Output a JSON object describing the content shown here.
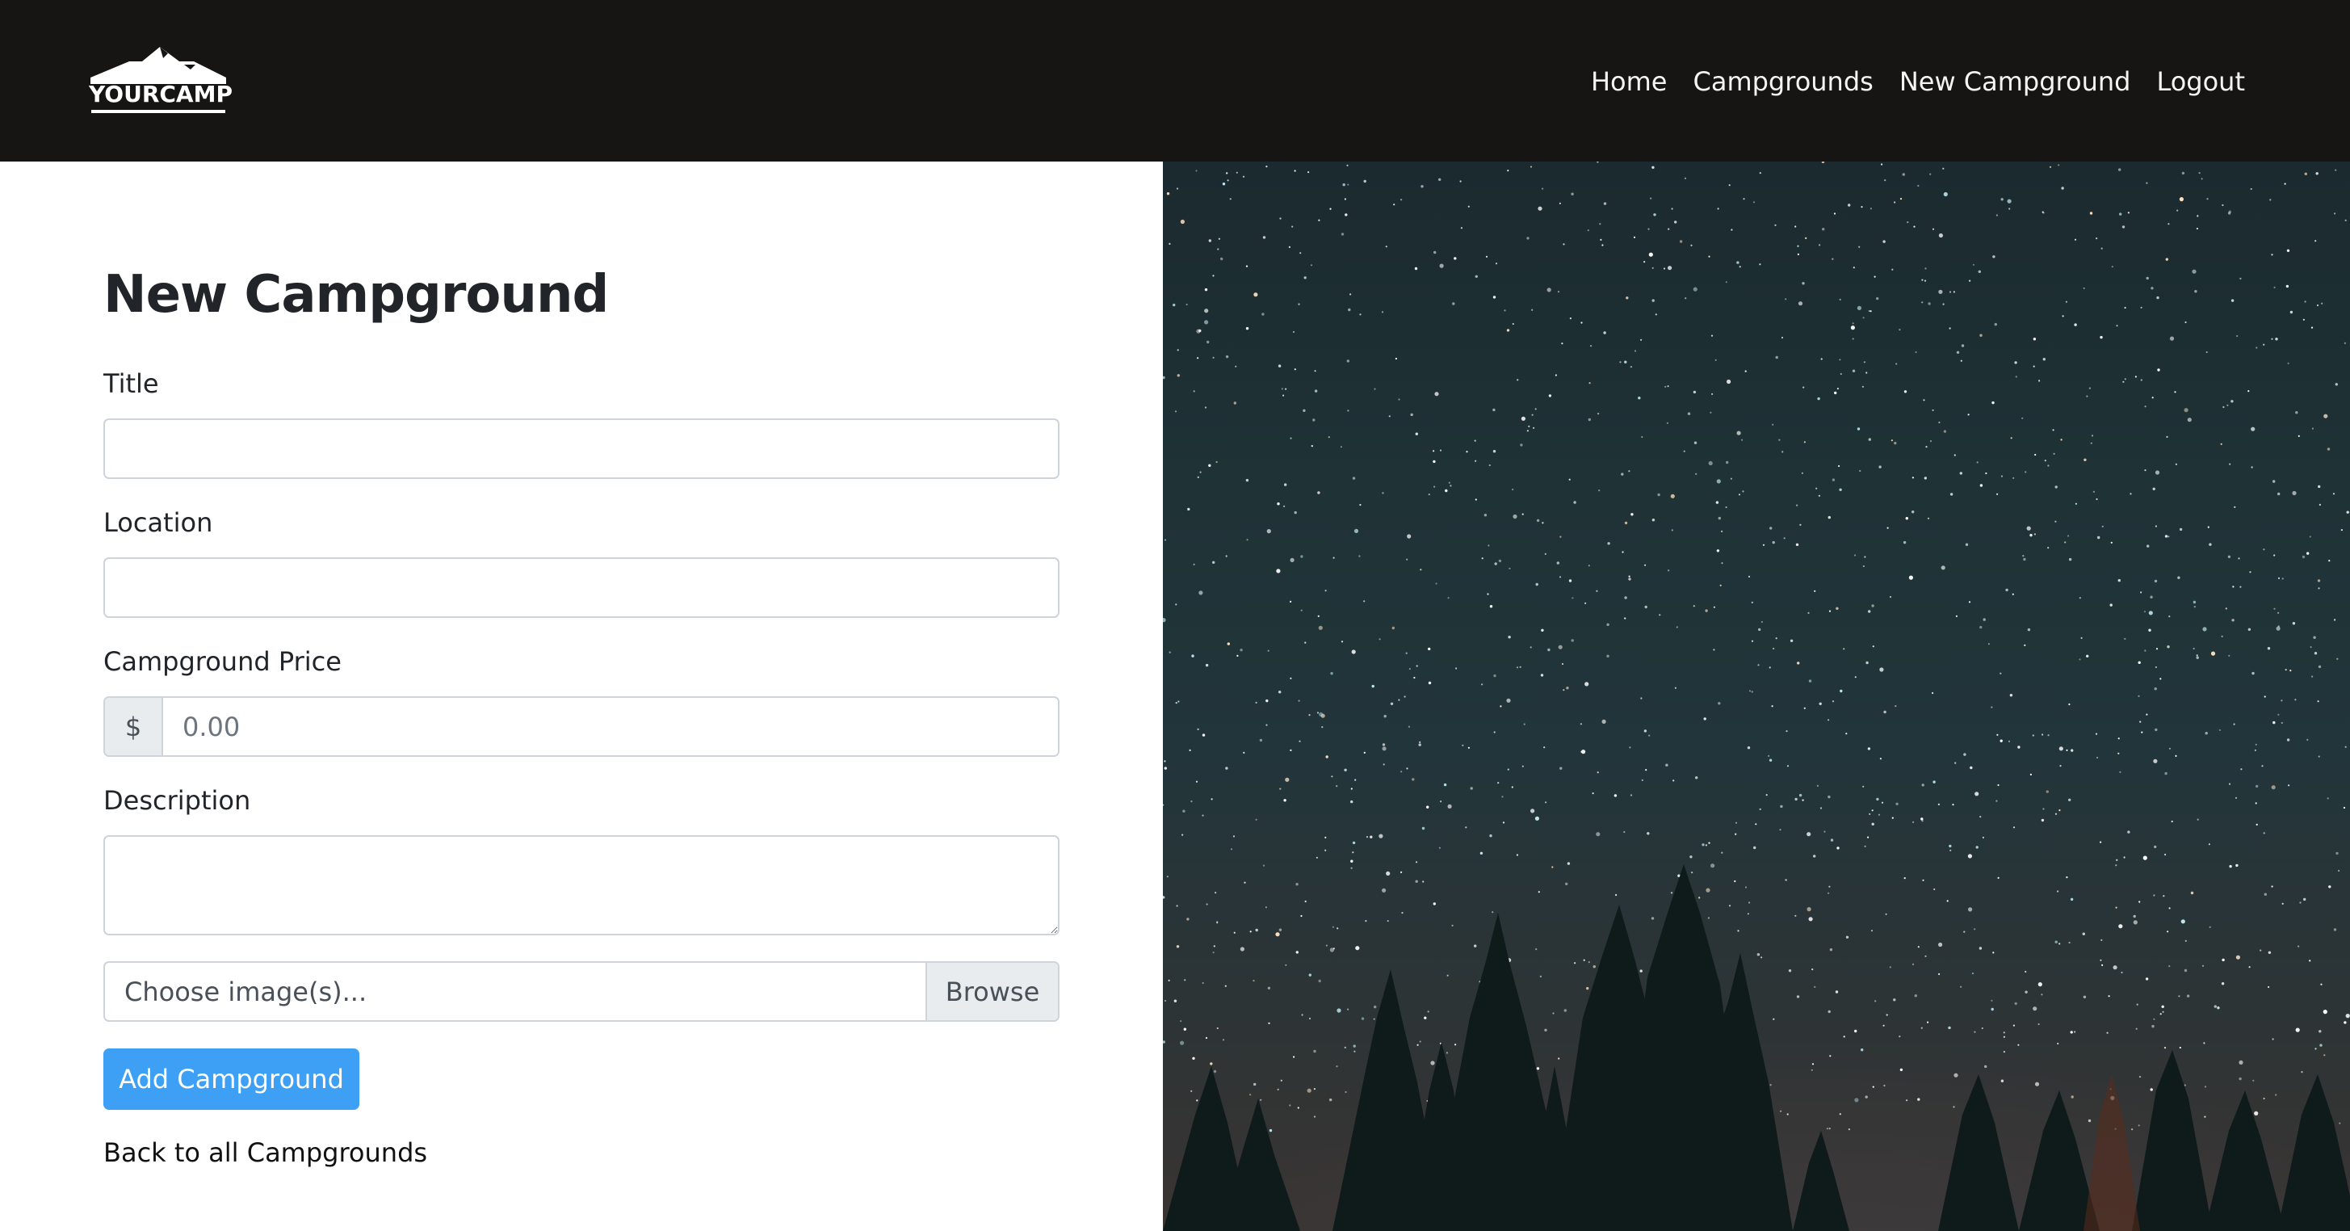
{
  "navbar": {
    "brand": "YOURCAMP",
    "links": [
      {
        "label": "Home"
      },
      {
        "label": "Campgrounds"
      },
      {
        "label": "New Campground"
      },
      {
        "label": "Logout"
      }
    ]
  },
  "form": {
    "title": "New Campground",
    "fields": {
      "title_label": "Title",
      "title_value": "",
      "location_label": "Location",
      "location_value": "",
      "price_label": "Campground Price",
      "price_addon": "$",
      "price_placeholder": "0.00",
      "description_label": "Description",
      "description_value": ""
    },
    "file_label": "Choose image(s)...",
    "file_browse": "Browse",
    "submit_label": "Add Campground",
    "back_link": "Back to all Campgrounds"
  },
  "hero": {
    "description_icon": "starry-night-forest-image"
  },
  "colors": {
    "navbar_bg": "#161513",
    "primary": "#3ea0f5",
    "text": "#212529"
  }
}
